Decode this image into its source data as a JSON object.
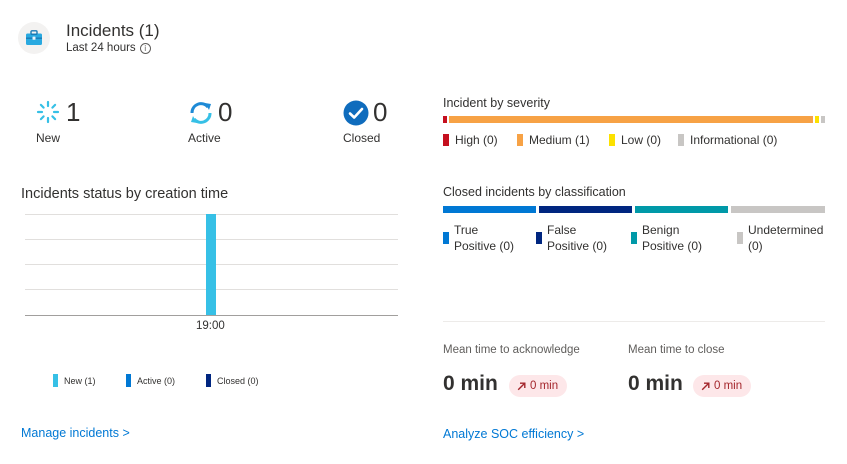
{
  "header": {
    "title": "Incidents (1)",
    "subtitle": "Last 24 hours",
    "icon": "briefcase-icon"
  },
  "stats": [
    {
      "value": "1",
      "label": "New",
      "icon": "spinner-icon"
    },
    {
      "value": "0",
      "label": "Active",
      "icon": "refresh-icon"
    },
    {
      "value": "0",
      "label": "Closed",
      "icon": "check-circle-icon"
    }
  ],
  "severity": {
    "title": "Incident by severity",
    "items": [
      {
        "label": "High (0)",
        "color": "#c50f1f",
        "count": 0
      },
      {
        "label": "Medium (1)",
        "color": "#f7a245",
        "count": 1
      },
      {
        "label": "Low (0)",
        "color": "#fce100",
        "count": 0
      },
      {
        "label": "Informational (0)",
        "color": "#c8c6c4",
        "count": 0
      }
    ]
  },
  "classification": {
    "title": "Closed incidents by classification",
    "items": [
      {
        "line1": "True",
        "line2": "Positive (0)",
        "color": "#0078d4"
      },
      {
        "line1": "False",
        "line2": "Positive (0)",
        "color": "#002680"
      },
      {
        "line1": "Benign",
        "line2": "Positive (0)",
        "color": "#0099a8"
      },
      {
        "line1": "Undetermined",
        "line2": "(0)",
        "color": "#c8c6c4"
      }
    ]
  },
  "chart": {
    "title": "Incidents status by creation time",
    "x_tick": "19:00",
    "legend": [
      {
        "label": "New (1)",
        "color": "#36c0e6"
      },
      {
        "label": "Active (0)",
        "color": "#0078d4"
      },
      {
        "label": "Closed (0)",
        "color": "#002680"
      }
    ]
  },
  "metrics": [
    {
      "label": "Mean time to acknowledge",
      "value": "0 min",
      "change": "0 min",
      "change_icon": "arrow-up-right-icon"
    },
    {
      "label": "Mean time to close",
      "value": "0 min",
      "change": "0 min",
      "change_icon": "arrow-up-right-icon"
    }
  ],
  "links": {
    "manage": "Manage incidents >",
    "analyze": "Analyze SOC efficiency >"
  }
}
